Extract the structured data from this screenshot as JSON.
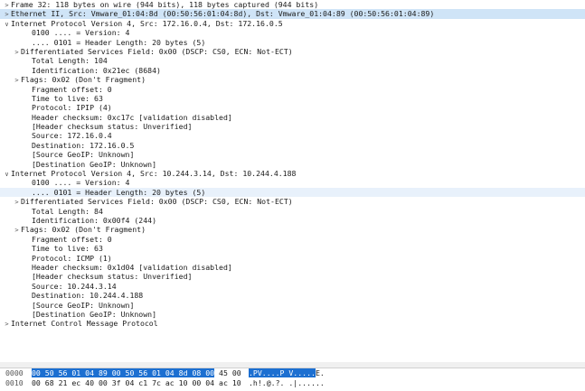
{
  "tree_rows": [
    {
      "text": "Frame 32: 118 bytes on wire (944 bits), 118 bytes captured (944 bits)",
      "level": 0,
      "expander": ">",
      "style": "normal"
    },
    {
      "text": "Ethernet II, Src: Vmware_01:04:8d (00:50:56:01:04:8d), Dst: Vmware_01:04:89 (00:50:56:01:04:89)",
      "level": 0,
      "expander": ">",
      "style": "sel"
    },
    {
      "text": "Internet Protocol Version 4, Src: 172.16.0.4, Dst: 172.16.0.5",
      "level": 0,
      "expander": "v",
      "style": "normal"
    },
    {
      "text": "0100 .... = Version: 4",
      "level": 2,
      "expander": "",
      "style": "normal"
    },
    {
      "text": ".... 0101 = Header Length: 20 bytes (5)",
      "level": 2,
      "expander": "",
      "style": "normal"
    },
    {
      "text": "Differentiated Services Field: 0x00 (DSCP: CS0, ECN: Not-ECT)",
      "level": 1,
      "expander": ">",
      "style": "normal"
    },
    {
      "text": "Total Length: 104",
      "level": 2,
      "expander": "",
      "style": "normal"
    },
    {
      "text": "Identification: 0x21ec (8684)",
      "level": 2,
      "expander": "",
      "style": "normal"
    },
    {
      "text": "Flags: 0x02 (Don't Fragment)",
      "level": 1,
      "expander": ">",
      "style": "normal"
    },
    {
      "text": "Fragment offset: 0",
      "level": 2,
      "expander": "",
      "style": "normal"
    },
    {
      "text": "Time to live: 63",
      "level": 2,
      "expander": "",
      "style": "normal"
    },
    {
      "text": "Protocol: IPIP (4)",
      "level": 2,
      "expander": "",
      "style": "normal"
    },
    {
      "text": "Header checksum: 0xc17c [validation disabled]",
      "level": 2,
      "expander": "",
      "style": "normal"
    },
    {
      "text": "[Header checksum status: Unverified]",
      "level": 2,
      "expander": "",
      "style": "normal"
    },
    {
      "text": "Source: 172.16.0.4",
      "level": 2,
      "expander": "",
      "style": "normal"
    },
    {
      "text": "Destination: 172.16.0.5",
      "level": 2,
      "expander": "",
      "style": "normal"
    },
    {
      "text": "[Source GeoIP: Unknown]",
      "level": 2,
      "expander": "",
      "style": "normal"
    },
    {
      "text": "[Destination GeoIP: Unknown]",
      "level": 2,
      "expander": "",
      "style": "normal"
    },
    {
      "text": "Internet Protocol Version 4, Src: 10.244.3.14, Dst: 10.244.4.188",
      "level": 0,
      "expander": "v",
      "style": "normal"
    },
    {
      "text": "0100 .... = Version: 4",
      "level": 2,
      "expander": "",
      "style": "normal"
    },
    {
      "text": ".... 0101 = Header Length: 20 bytes (5)",
      "level": 2,
      "expander": "",
      "style": "hover"
    },
    {
      "text": "Differentiated Services Field: 0x00 (DSCP: CS0, ECN: Not-ECT)",
      "level": 1,
      "expander": ">",
      "style": "normal"
    },
    {
      "text": "Total Length: 84",
      "level": 2,
      "expander": "",
      "style": "normal"
    },
    {
      "text": "Identification: 0x00f4 (244)",
      "level": 2,
      "expander": "",
      "style": "normal"
    },
    {
      "text": "Flags: 0x02 (Don't Fragment)",
      "level": 1,
      "expander": ">",
      "style": "normal"
    },
    {
      "text": "Fragment offset: 0",
      "level": 2,
      "expander": "",
      "style": "normal"
    },
    {
      "text": "Time to live: 63",
      "level": 2,
      "expander": "",
      "style": "normal"
    },
    {
      "text": "Protocol: ICMP (1)",
      "level": 2,
      "expander": "",
      "style": "normal"
    },
    {
      "text": "Header checksum: 0x1d04 [validation disabled]",
      "level": 2,
      "expander": "",
      "style": "normal"
    },
    {
      "text": "[Header checksum status: Unverified]",
      "level": 2,
      "expander": "",
      "style": "normal"
    },
    {
      "text": "Source: 10.244.3.14",
      "level": 2,
      "expander": "",
      "style": "normal"
    },
    {
      "text": "Destination: 10.244.4.188",
      "level": 2,
      "expander": "",
      "style": "normal"
    },
    {
      "text": "[Source GeoIP: Unknown]",
      "level": 2,
      "expander": "",
      "style": "normal"
    },
    {
      "text": "[Destination GeoIP: Unknown]",
      "level": 2,
      "expander": "",
      "style": "normal"
    },
    {
      "text": "Internet Control Message Protocol",
      "level": 0,
      "expander": ">",
      "style": "normal"
    }
  ],
  "hex_rows": [
    {
      "offset": "0000",
      "bytes_hl": "00 50 56 01 04 89 00 50  56 01 04 8d 08 00",
      "bytes_rest": " 45 00",
      "ascii_hl": ".PV....P V.....",
      "ascii_rest": "E."
    },
    {
      "offset": "0010",
      "bytes_hl": "",
      "bytes_rest": "00 68 21 ec 40 00 3f 04  c1 7c ac 10 00 04 ac 10",
      "ascii_hl": "",
      "ascii_rest": ".h!.@.?. .|......"
    }
  ],
  "colors": {
    "selected_row": "#cfe4f7",
    "hex_highlight": "#1c6fd1"
  }
}
